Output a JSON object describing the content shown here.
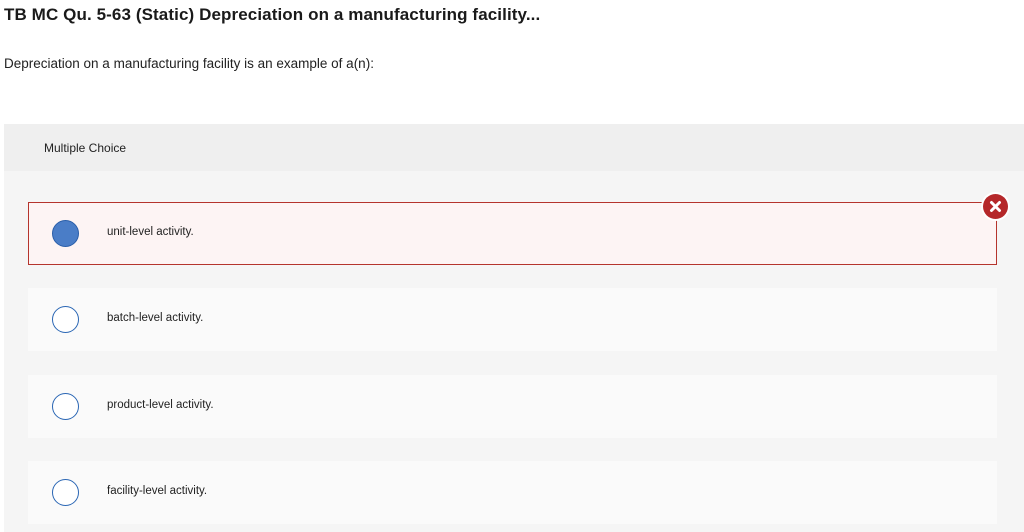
{
  "title": "TB MC Qu. 5-63 (Static) Depreciation on a manufacturing facility...",
  "question": "Depreciation on a manufacturing facility is an example of a(n):",
  "multiple_choice": {
    "label": "Multiple Choice",
    "options": [
      {
        "text": "unit-level activity.",
        "selected": true,
        "status": "incorrect"
      },
      {
        "text": "batch-level activity.",
        "selected": false
      },
      {
        "text": "product-level activity.",
        "selected": false
      },
      {
        "text": "facility-level activity.",
        "selected": false
      }
    ]
  },
  "icons": {
    "incorrect_marker": "close-x-icon",
    "radio": "radio-icon"
  },
  "colors": {
    "incorrect": "#b5282a",
    "selected_radio": "#4a7dc7",
    "radio_border": "#2a66b4"
  }
}
